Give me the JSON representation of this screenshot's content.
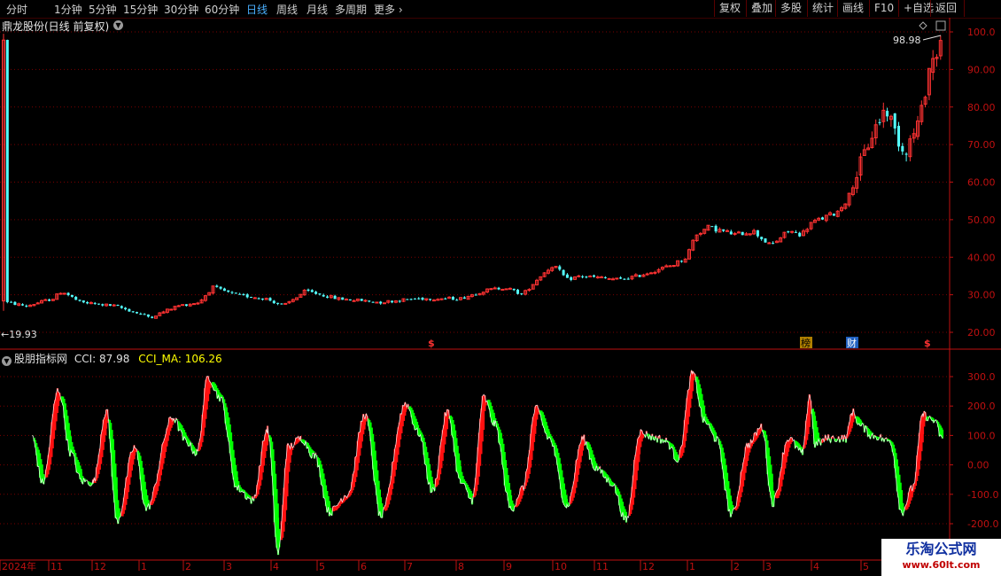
{
  "toolbar": {
    "periods": [
      "分时",
      "1分钟",
      "5分钟",
      "15分钟",
      "30分钟",
      "60分钟",
      "日线",
      "周线",
      "月线",
      "多周期",
      "更多"
    ],
    "active_period": "日线",
    "buttons": [
      "复权",
      "叠加",
      "多股",
      "统计",
      "画线",
      "F10",
      "+自选",
      "返回"
    ]
  },
  "stock": {
    "title": "鼎龙股份(日线 前复权)"
  },
  "indicator": {
    "name": "股朋指标网",
    "cci_label": "CCI: 87.98",
    "cci_ma_label": "CCI_MA: 106.26"
  },
  "annotations": {
    "high_label": "98.98",
    "low_label": "←19.93",
    "bang": "榜",
    "cai": "财",
    "dollar": "$"
  },
  "colors": {
    "up": "#ff3232",
    "down": "#54ffff",
    "grid": "#7a0000",
    "axis": "#c01010",
    "cci_up": "#ff1010",
    "cci_down": "#00ff00",
    "cci_line": "#ffffff",
    "cci_ma": "#ffff00"
  },
  "chart_data": [
    {
      "type": "candlestick",
      "title": "鼎龙股份(日线 前复权)",
      "y_ticks": [
        "100.0",
        "90.00",
        "80.00",
        "70.00",
        "60.00",
        "50.00",
        "40.00",
        "30.00",
        "20.00"
      ],
      "ylim": [
        17,
        102
      ],
      "high": 98.98,
      "low": 19.93,
      "approx_close_path": [
        {
          "label": "2024-10",
          "close": 28
        },
        {
          "label": "2024-11",
          "close": 27
        },
        {
          "label": "2024-12",
          "close": 27
        },
        {
          "label": "2025-01",
          "close": 25
        },
        {
          "label": "2025-02",
          "close": 26
        },
        {
          "label": "2025-03",
          "close": 31
        },
        {
          "label": "2025-04",
          "close": 29
        },
        {
          "label": "2025-05",
          "close": 29
        },
        {
          "label": "2025-06",
          "close": 28
        },
        {
          "label": "2025-07",
          "close": 28
        },
        {
          "label": "2025-08",
          "close": 31
        },
        {
          "label": "2025-09",
          "close": 38
        },
        {
          "label": "2025-10",
          "close": 35
        },
        {
          "label": "2025-11",
          "close": 36
        },
        {
          "label": "2025-12",
          "close": 40
        },
        {
          "label": "2026-01",
          "close": 48
        },
        {
          "label": "2026-02",
          "close": 45
        },
        {
          "label": "2026-03",
          "close": 46
        },
        {
          "label": "2026-04",
          "close": 52
        },
        {
          "label": "2026-05",
          "close": 80
        },
        {
          "label": "2026-05b",
          "close": 95
        }
      ]
    },
    {
      "type": "line",
      "title": "股朋指标网",
      "series": [
        {
          "name": "CCI",
          "last": 87.98
        },
        {
          "name": "CCI_MA",
          "last": 106.26
        }
      ],
      "y_ticks": [
        "300.0",
        "200.0",
        "100.0",
        "0.00",
        "-100.0",
        "-200.0"
      ],
      "ylim": [
        -230,
        340
      ]
    }
  ],
  "x_axis": {
    "labels": [
      "2024年",
      "11",
      "12",
      "1",
      "2",
      "3",
      "4",
      "5",
      "6",
      "7",
      "8",
      "9",
      "10",
      "11",
      "12",
      "1",
      "2",
      "3",
      "4",
      "5"
    ]
  }
}
